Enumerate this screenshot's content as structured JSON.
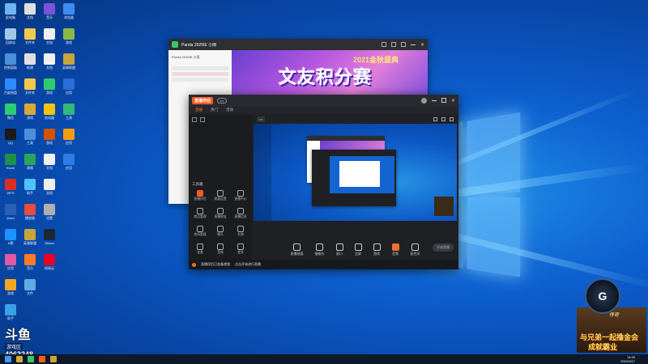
{
  "desktop": {
    "icons_col1": [
      {
        "label": "此电脑",
        "color": "#6fb4f0",
        "icon": "computer-icon"
      },
      {
        "label": "回收站",
        "color": "#9fc7ea",
        "icon": "recycle-bin-icon"
      },
      {
        "label": "控制面板",
        "color": "#4a8fd8",
        "icon": "control-panel-icon"
      },
      {
        "label": "百度网盘",
        "color": "#2e8bff",
        "icon": "cloud-icon"
      },
      {
        "label": "微信",
        "color": "#2ecc71",
        "icon": "wechat-icon"
      },
      {
        "label": "QQ",
        "color": "#1a1a1a",
        "icon": "qq-icon"
      },
      {
        "label": "Excel",
        "color": "#1f8f4a",
        "icon": "excel-icon"
      },
      {
        "label": "WPS",
        "color": "#d93025",
        "icon": "wps-icon"
      },
      {
        "label": "Word",
        "color": "#2b5fb8",
        "icon": "word-icon"
      },
      {
        "label": "K歌",
        "color": "#1e90ff",
        "icon": "k-icon"
      },
      {
        "label": "应用",
        "color": "#e05aa0",
        "icon": "app-icon"
      },
      {
        "label": "游戏",
        "color": "#f5a623",
        "icon": "game-icon"
      },
      {
        "label": "助手",
        "color": "#3ba0e6",
        "icon": "assistant-icon"
      }
    ],
    "icons_col2": [
      {
        "label": "文档",
        "color": "#e0e0e0",
        "icon": "document-icon"
      },
      {
        "label": "文件夹",
        "color": "#f2c94c",
        "icon": "folder-icon"
      },
      {
        "label": "新建",
        "color": "#e0e0e0",
        "icon": "file-icon"
      },
      {
        "label": "文件夹",
        "color": "#f2c94c",
        "icon": "folder-icon"
      },
      {
        "label": "游戏",
        "color": "#d8a838",
        "icon": "game-icon"
      },
      {
        "label": "工具",
        "color": "#4a8fd8",
        "icon": "tool-icon"
      },
      {
        "label": "表格",
        "color": "#2aa55a",
        "icon": "sheet-icon"
      },
      {
        "label": "助手",
        "color": "#4fc3f7",
        "icon": "assistant-icon"
      },
      {
        "label": "播放器",
        "color": "#e74c3c",
        "icon": "player-icon"
      },
      {
        "label": "英雄联盟",
        "color": "#c9a43a",
        "icon": "lol-icon"
      },
      {
        "label": "音乐",
        "color": "#ff7a2a",
        "icon": "music-icon"
      },
      {
        "label": "文件",
        "color": "#5dade2",
        "icon": "file-icon"
      }
    ],
    "icons_col3": [
      {
        "label": "音乐",
        "color": "#7b52d9",
        "icon": "music-icon"
      },
      {
        "label": "文档",
        "color": "#f0f0f0",
        "icon": "document-icon"
      },
      {
        "label": "文档",
        "color": "#f0f0f0",
        "icon": "document-icon"
      },
      {
        "label": "游戏",
        "color": "#2ecc71",
        "icon": "game-icon"
      },
      {
        "label": "启动器",
        "color": "#f1c40f",
        "icon": "launcher-icon"
      },
      {
        "label": "游戏",
        "color": "#d35400",
        "icon": "game-icon"
      },
      {
        "label": "文档",
        "color": "#f0f0f0",
        "icon": "document-icon"
      },
      {
        "label": "文档",
        "color": "#f0f0f0",
        "icon": "document-icon"
      },
      {
        "label": "设置",
        "color": "#b0b0b0",
        "icon": "settings-icon"
      },
      {
        "label": "Steam",
        "color": "#1b2838",
        "icon": "steam-icon"
      },
      {
        "label": "网易云",
        "color": "#e60026",
        "icon": "netease-icon"
      }
    ],
    "icons_col4": [
      {
        "label": "浏览器",
        "color": "#3d8ef0",
        "icon": "browser-icon"
      },
      {
        "label": "游戏",
        "color": "#8bb84a",
        "icon": "game-icon"
      },
      {
        "label": "英雄联盟",
        "color": "#c9a43a",
        "icon": "lol-icon"
      },
      {
        "label": "应用",
        "color": "#2a6cd8",
        "icon": "app-icon"
      },
      {
        "label": "工具",
        "color": "#34b77a",
        "icon": "tool-icon"
      },
      {
        "label": "应用",
        "color": "#f39c12",
        "icon": "app-icon"
      },
      {
        "label": "应用",
        "color": "#2d7be5",
        "icon": "app-icon"
      }
    ]
  },
  "win1": {
    "title": "Panda 2025IE 小雨",
    "banner_title": "文友积分赛",
    "banner_subtitle": "2021金秋盛典",
    "side_label": "Panda 2025IE 小雨",
    "orange_bar": "开播前请先阅读直播规范"
  },
  "win2": {
    "logo": "直播伴侣",
    "tabs": [
      "直播",
      "热门",
      "活动"
    ],
    "left_tools_label": "工具箱",
    "tools": [
      "直播伴侣",
      "观看设置",
      "直播中心",
      "商品管理",
      "直播收益",
      "直播信息",
      "房间管理",
      "聊天",
      "礼物",
      "连麦",
      "音效",
      "更多"
    ],
    "controls": [
      "直播画面",
      "摄像头",
      "窗口",
      "全屏",
      "游戏",
      "音频",
      "麦克风"
    ],
    "start_button": "开始直播",
    "status_text": "直播伴侣已准备就绪",
    "status_text2": "点击开始进行直播"
  },
  "watermark": {
    "logo": "斗鱼",
    "name": "游戏区",
    "room": "4062248"
  },
  "promo": {
    "circle_letter": "G",
    "line1": "与兄弟一起撸金会",
    "line2": "成就霸业",
    "top": "传奇"
  },
  "taskbar": {
    "time": "14:30",
    "date": "2021/9/17"
  }
}
